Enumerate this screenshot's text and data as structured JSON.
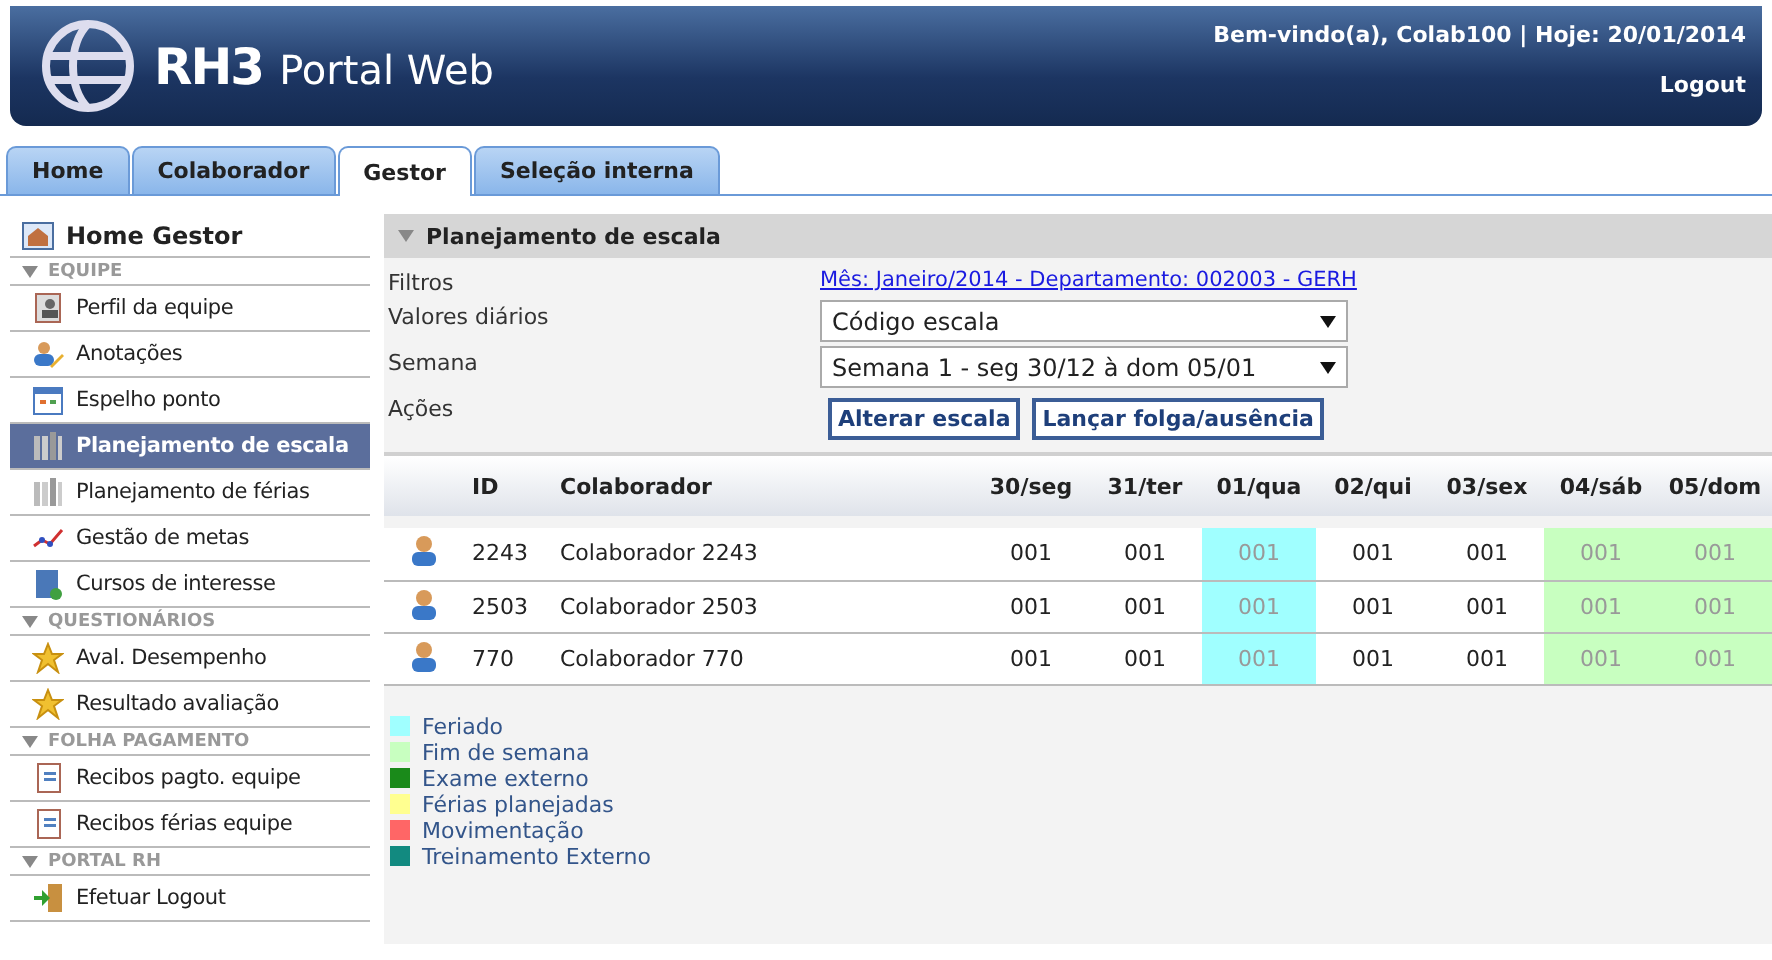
{
  "header": {
    "brand": "RH3",
    "product": "Portal Web",
    "welcome": "Bem-vindo(a), Colab100 | Hoje: 20/01/2014",
    "logout": "Logout"
  },
  "tabs": [
    {
      "label": "Home",
      "selected": false
    },
    {
      "label": "Colaborador",
      "selected": false
    },
    {
      "label": "Gestor",
      "selected": true
    },
    {
      "label": "Seleção interna",
      "selected": false
    }
  ],
  "sidebar": {
    "home": "Home Gestor",
    "sections": [
      {
        "title": "EQUIPE",
        "items": [
          {
            "label": "Perfil da equipe",
            "kind": "profile",
            "selected": false
          },
          {
            "label": "Anotações",
            "kind": "notes",
            "selected": false
          },
          {
            "label": "Espelho ponto",
            "kind": "calendar",
            "selected": false
          },
          {
            "label": "Planejamento de escala",
            "kind": "bars",
            "selected": true
          },
          {
            "label": "Planejamento de férias",
            "kind": "bars",
            "selected": false
          },
          {
            "label": "Gestão de metas",
            "kind": "chart",
            "selected": false
          },
          {
            "label": "Cursos de interesse",
            "kind": "book",
            "selected": false
          }
        ]
      },
      {
        "title": "QUESTIONÁRIOS",
        "items": [
          {
            "label": "Aval. Desempenho",
            "kind": "star",
            "selected": false
          },
          {
            "label": "Resultado avaliação",
            "kind": "star",
            "selected": false
          }
        ]
      },
      {
        "title": "FOLHA PAGAMENTO",
        "items": [
          {
            "label": "Recibos pagto. equipe",
            "kind": "doc",
            "selected": false
          },
          {
            "label": "Recibos férias equipe",
            "kind": "doc",
            "selected": false
          }
        ]
      },
      {
        "title": "PORTAL RH",
        "items": [
          {
            "label": "Efetuar Logout",
            "kind": "door",
            "selected": false
          }
        ]
      }
    ]
  },
  "panel": {
    "title": "Planejamento de escala",
    "filters": {
      "label": "Filtros",
      "link": "Mês: Janeiro/2014 - Departamento: 002003 - GERH"
    },
    "daily_values": {
      "label": "Valores diários",
      "value": "Código escala"
    },
    "week": {
      "label": "Semana",
      "value": "Semana 1 - seg 30/12 à dom 05/01"
    },
    "actions": {
      "label": "Ações",
      "buttons": [
        "Alterar escala",
        "Lançar folga/ausência"
      ]
    },
    "table": {
      "columns": [
        "ID",
        "Colaborador"
      ],
      "days": [
        {
          "label": "30/seg",
          "kind": "normal"
        },
        {
          "label": "31/ter",
          "kind": "normal"
        },
        {
          "label": "01/qua",
          "kind": "holiday"
        },
        {
          "label": "02/qui",
          "kind": "normal"
        },
        {
          "label": "03/sex",
          "kind": "normal"
        },
        {
          "label": "04/sáb",
          "kind": "weekend"
        },
        {
          "label": "05/dom",
          "kind": "weekend"
        }
      ],
      "rows": [
        {
          "id": "2243",
          "name": "Colaborador 2243",
          "cells": [
            "001",
            "001",
            "001",
            "001",
            "001",
            "001",
            "001"
          ]
        },
        {
          "id": "2503",
          "name": "Colaborador 2503",
          "cells": [
            "001",
            "001",
            "001",
            "001",
            "001",
            "001",
            "001"
          ]
        },
        {
          "id": "770",
          "name": "Colaborador 770",
          "cells": [
            "001",
            "001",
            "001",
            "001",
            "001",
            "001",
            "001"
          ]
        }
      ]
    },
    "legend": [
      {
        "label": "Feriado",
        "color": "#a0ffff"
      },
      {
        "label": "Fim de semana",
        "color": "#c8ffc0"
      },
      {
        "label": "Exame externo",
        "color": "#1a8a1a"
      },
      {
        "label": "Férias planejadas",
        "color": "#ffff90"
      },
      {
        "label": "Movimentação",
        "color": "#ff6666"
      },
      {
        "label": "Treinamento Externo",
        "color": "#128a80"
      }
    ]
  }
}
